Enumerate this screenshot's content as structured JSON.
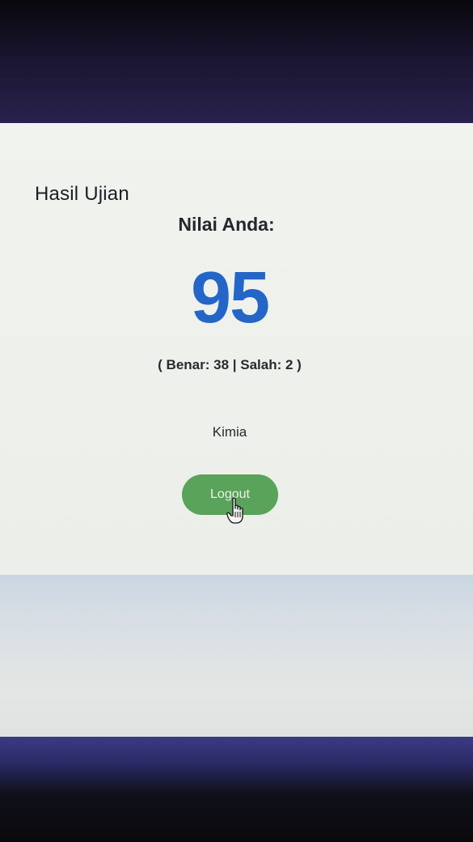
{
  "page": {
    "title": "Hasil Ujian"
  },
  "result": {
    "score_label": "Nilai Anda:",
    "score": "95",
    "detail": "( Benar: 38 | Salah: 2 )",
    "subject": "Kimia"
  },
  "actions": {
    "logout_label": "Logout"
  },
  "colors": {
    "score": "#2466c8",
    "logout_button": "#5aa35a"
  },
  "icons": {
    "cursor": "hand-pointer-icon"
  }
}
